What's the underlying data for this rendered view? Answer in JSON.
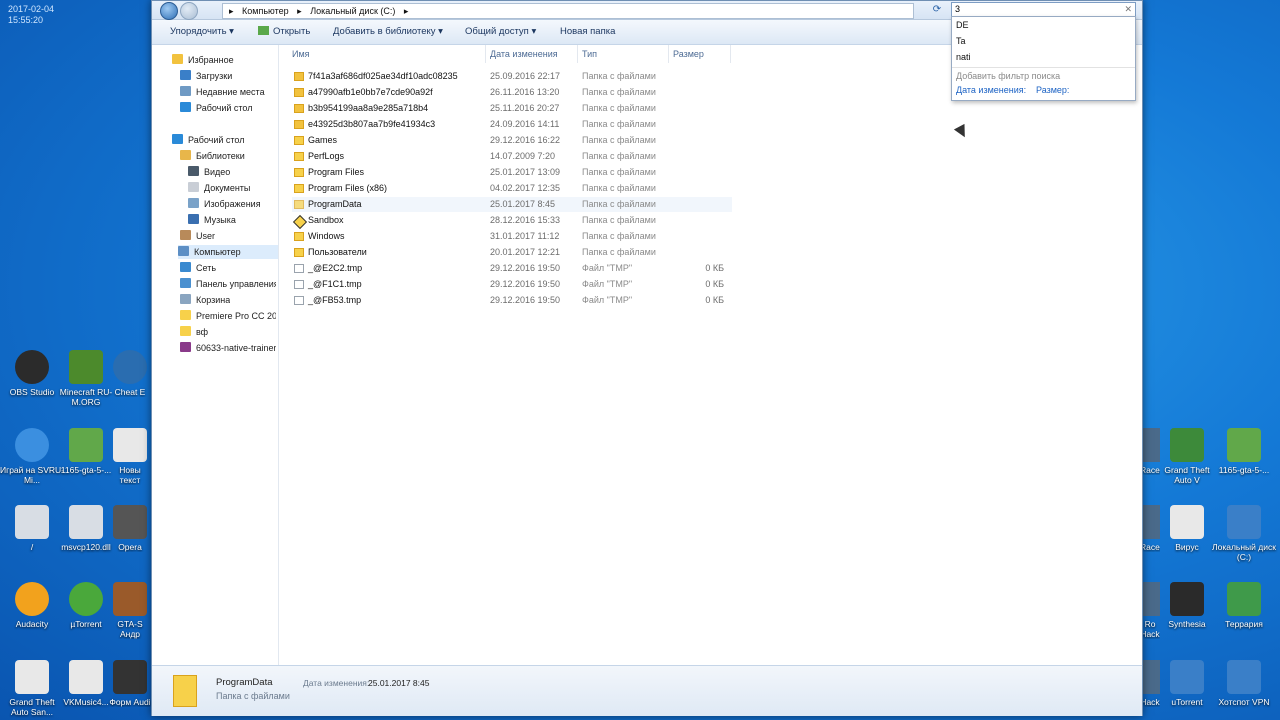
{
  "clock": {
    "date": "2017-02-04",
    "time": "15:55:20"
  },
  "desktop_left": [
    {
      "label": "OBS Studio",
      "color": "#2b2b2b"
    },
    {
      "label": "Minecraft RU-M.ORG",
      "color": "#4c8a2c"
    },
    {
      "label": "Cheat E",
      "color": "#2a6db0"
    },
    {
      "label": "Играй на SVRU-Mi...",
      "color": "#3b8fe0"
    },
    {
      "label": "1165-gta-5-...",
      "color": "#61a84a"
    },
    {
      "label": "Новы текст",
      "color": "#e8e8e8"
    },
    {
      "label": "/",
      "color": "#d8dde4"
    },
    {
      "label": "msvcp120.dll",
      "color": "#d8dde4"
    },
    {
      "label": "Opera",
      "color": "#555555"
    },
    {
      "label": "Audacity",
      "color": "#f2a21d"
    },
    {
      "label": "µTorrent",
      "color": "#4aa83b"
    },
    {
      "label": "GTA-S Андр",
      "color": "#9a5a2a"
    },
    {
      "label": "Grand Theft Auto San...",
      "color": "#e8e8e8"
    },
    {
      "label": "VKMusic4...",
      "color": "#e8e8e8"
    },
    {
      "label": "Форм Audi",
      "color": "#333333"
    }
  ],
  "desktop_right": [
    {
      "label": "Racer",
      "color": "#4a6a8a"
    },
    {
      "label": "Grand Theft Auto V",
      "color": "#3d8a3a"
    },
    {
      "label": "1165-gta-5-...",
      "color": "#61a84a"
    },
    {
      "label": "Racer",
      "color": "#4a6a8a"
    },
    {
      "label": "Вирус",
      "color": "#e8e8e8"
    },
    {
      "label": "Локальный диск (C:)",
      "color": "#3a7fc8"
    },
    {
      "label": "Ro Hack",
      "color": "#4a6a8a"
    },
    {
      "label": "Synthesia",
      "color": "#2a2a2a"
    },
    {
      "label": "Террария",
      "color": "#3f9a4a"
    },
    {
      "label": "Hack",
      "color": "#4a6a8a"
    },
    {
      "label": "uTorrent",
      "color": "#3a7fc8"
    },
    {
      "label": "Хотспот VPN",
      "color": "#3a7fc8"
    }
  ],
  "address": {
    "crumbs": [
      "Компьютер",
      "Локальный диск (C:)"
    ]
  },
  "search": {
    "value": "3"
  },
  "toolbar": {
    "organize": "Упорядочить",
    "open": "Открыть",
    "add_library": "Добавить в библиотеку",
    "share": "Общий доступ",
    "new_folder": "Новая папка"
  },
  "nav": {
    "favorites": "Избранное",
    "downloads": "Загрузки",
    "recent": "Недавние места",
    "desktop": "Рабочий стол",
    "desktop2": "Рабочий стол",
    "libraries": "Библиотеки",
    "video": "Видео",
    "docs": "Документы",
    "images": "Изображения",
    "music": "Музыка",
    "user": "User",
    "computer": "Компьютер",
    "network": "Сеть",
    "control": "Панель управления",
    "recycle": "Корзина",
    "premiere": "Premiere Pro CC 2015",
    "vf": "вф",
    "trainer": "60633-native-trainer"
  },
  "columns": {
    "name": "Имя",
    "date": "Дата изменения",
    "type": "Тип",
    "size": "Размер"
  },
  "files": [
    {
      "name": "7f41a3af686df025ae34df10adc08235",
      "date": "25.09.2016 22:17",
      "type": "Папка с файлами",
      "size": "",
      "icon": "lock"
    },
    {
      "name": "a47990afb1e0bb7e7cde90a92f",
      "date": "26.11.2016 13:20",
      "type": "Папка с файлами",
      "size": "",
      "icon": "lock"
    },
    {
      "name": "b3b954199aa8a9e285a718b4",
      "date": "25.11.2016 20:27",
      "type": "Папка с файлами",
      "size": "",
      "icon": "lock"
    },
    {
      "name": "e43925d3b807aa7b9fe41934c3",
      "date": "24.09.2016 14:11",
      "type": "Папка с файлами",
      "size": "",
      "icon": "lock"
    },
    {
      "name": "Games",
      "date": "29.12.2016 16:22",
      "type": "Папка с файлами",
      "size": "",
      "icon": "folder"
    },
    {
      "name": "PerfLogs",
      "date": "14.07.2009 7:20",
      "type": "Папка с файлами",
      "size": "",
      "icon": "folder"
    },
    {
      "name": "Program Files",
      "date": "25.01.2017 13:09",
      "type": "Папка с файлами",
      "size": "",
      "icon": "folder"
    },
    {
      "name": "Program Files (x86)",
      "date": "04.02.2017 12:35",
      "type": "Папка с файлами",
      "size": "",
      "icon": "folder"
    },
    {
      "name": "ProgramData",
      "date": "25.01.2017 8:45",
      "type": "Папка с файлами",
      "size": "",
      "icon": "folder"
    },
    {
      "name": "Sandbox",
      "date": "28.12.2016 15:33",
      "type": "Папка с файлами",
      "size": "",
      "icon": "sandbox"
    },
    {
      "name": "Windows",
      "date": "31.01.2017 11:12",
      "type": "Папка с файлами",
      "size": "",
      "icon": "folder"
    },
    {
      "name": "Пользователи",
      "date": "20.01.2017 12:21",
      "type": "Папка с файлами",
      "size": "",
      "icon": "folder"
    },
    {
      "name": "_@E2C2.tmp",
      "date": "29.12.2016 19:50",
      "type": "Файл \"TMP\"",
      "size": "0 КБ",
      "icon": "file"
    },
    {
      "name": "_@F1C1.tmp",
      "date": "29.12.2016 19:50",
      "type": "Файл \"TMP\"",
      "size": "0 КБ",
      "icon": "file"
    },
    {
      "name": "_@FB53.tmp",
      "date": "29.12.2016 19:50",
      "type": "Файл \"TMP\"",
      "size": "0 КБ",
      "icon": "file"
    }
  ],
  "dropdown": {
    "items": [
      "DE",
      "Ta",
      "nati"
    ],
    "hint": "Добавить фильтр поиска",
    "filter_date": "Дата изменения:",
    "filter_size": "Размер:"
  },
  "status": {
    "name": "ProgramData",
    "type": "Папка с файлами",
    "date_label": "Дата изменения:",
    "date_value": "25.01.2017 8:45"
  }
}
